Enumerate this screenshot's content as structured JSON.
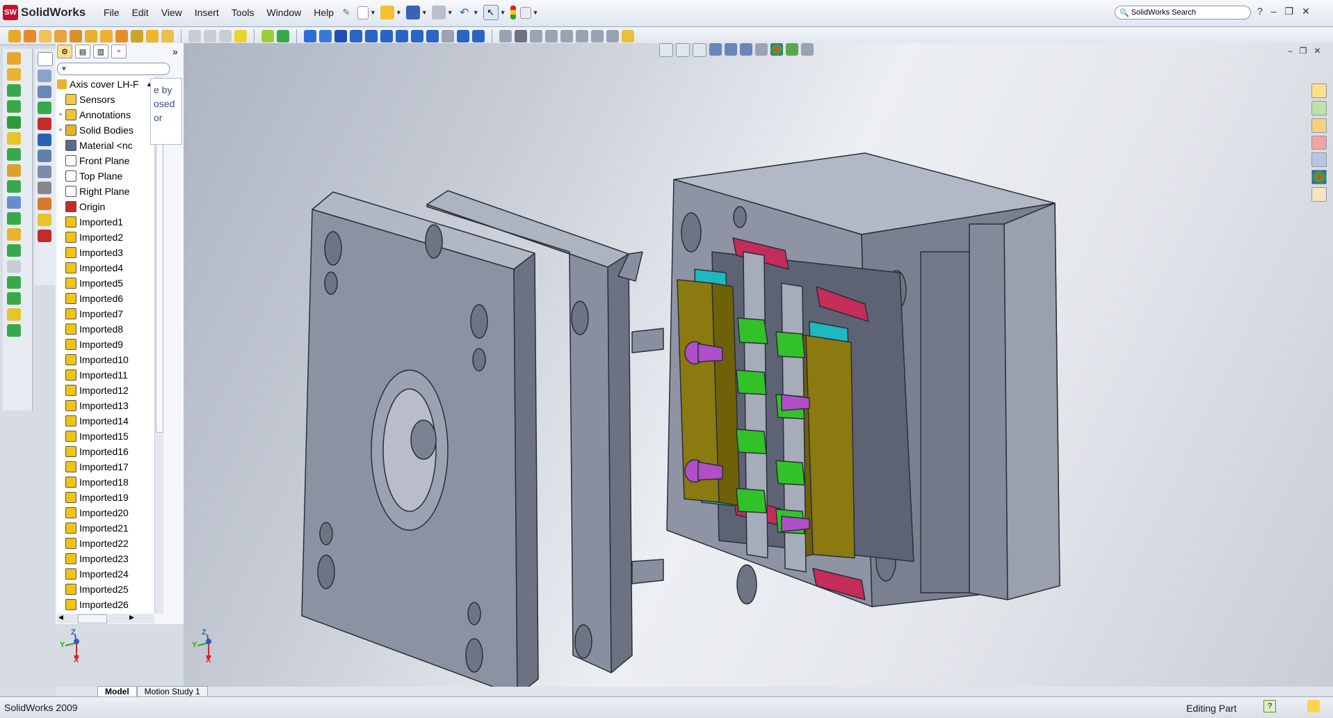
{
  "app": {
    "logo_text": "SolidWorks",
    "logo_badge": "SW",
    "menu": [
      "File",
      "Edit",
      "View",
      "Insert",
      "Tools",
      "Window",
      "Help"
    ],
    "search_placeholder": "SolidWorks Search"
  },
  "feature_manager": {
    "tabs": [
      "part-tab",
      "property-tab",
      "config-tab",
      "dimxpert-tab"
    ],
    "root": "Axis cover LH-F",
    "items": [
      {
        "label": "Sensors",
        "icon": "sensors-icon",
        "expandable": false
      },
      {
        "label": "Annotations",
        "icon": "annotations-icon",
        "expandable": true
      },
      {
        "label": "Solid Bodies",
        "icon": "solid-bodies-icon",
        "expandable": true
      },
      {
        "label": "Material <nc",
        "icon": "material-icon",
        "expandable": false
      },
      {
        "label": "Front Plane",
        "icon": "plane-icon",
        "expandable": false
      },
      {
        "label": "Top Plane",
        "icon": "plane-icon",
        "expandable": false
      },
      {
        "label": "Right Plane",
        "icon": "plane-icon",
        "expandable": false
      },
      {
        "label": "Origin",
        "icon": "origin-icon",
        "expandable": false
      },
      {
        "label": "Imported1",
        "icon": "imported-feature-icon",
        "expandable": false
      },
      {
        "label": "Imported2",
        "icon": "imported-feature-icon",
        "expandable": false
      },
      {
        "label": "Imported3",
        "icon": "imported-feature-icon",
        "expandable": false
      },
      {
        "label": "Imported4",
        "icon": "imported-feature-icon",
        "expandable": false
      },
      {
        "label": "Imported5",
        "icon": "imported-feature-icon",
        "expandable": false
      },
      {
        "label": "Imported6",
        "icon": "imported-feature-icon",
        "expandable": false
      },
      {
        "label": "Imported7",
        "icon": "imported-feature-icon",
        "expandable": false
      },
      {
        "label": "Imported8",
        "icon": "imported-feature-icon",
        "expandable": false
      },
      {
        "label": "Imported9",
        "icon": "imported-feature-icon",
        "expandable": false
      },
      {
        "label": "Imported10",
        "icon": "imported-feature-icon",
        "expandable": false
      },
      {
        "label": "Imported11",
        "icon": "imported-feature-icon",
        "expandable": false
      },
      {
        "label": "Imported12",
        "icon": "imported-feature-icon",
        "expandable": false
      },
      {
        "label": "Imported13",
        "icon": "imported-feature-icon",
        "expandable": false
      },
      {
        "label": "Imported14",
        "icon": "imported-feature-icon",
        "expandable": false
      },
      {
        "label": "Imported15",
        "icon": "imported-feature-icon",
        "expandable": false
      },
      {
        "label": "Imported16",
        "icon": "imported-feature-icon",
        "expandable": false
      },
      {
        "label": "Imported17",
        "icon": "imported-feature-icon",
        "expandable": false
      },
      {
        "label": "Imported18",
        "icon": "imported-feature-icon",
        "expandable": false
      },
      {
        "label": "Imported19",
        "icon": "imported-feature-icon",
        "expandable": false
      },
      {
        "label": "Imported20",
        "icon": "imported-feature-icon",
        "expandable": false
      },
      {
        "label": "Imported21",
        "icon": "imported-feature-icon",
        "expandable": false
      },
      {
        "label": "Imported22",
        "icon": "imported-feature-icon",
        "expandable": false
      },
      {
        "label": "Imported23",
        "icon": "imported-feature-icon",
        "expandable": false
      },
      {
        "label": "Imported24",
        "icon": "imported-feature-icon",
        "expandable": false
      },
      {
        "label": "Imported25",
        "icon": "imported-feature-icon",
        "expandable": false
      },
      {
        "label": "Imported26",
        "icon": "imported-feature-icon",
        "expandable": false
      }
    ],
    "tip_fragment": "e by\nosed\nor"
  },
  "triad": {
    "x": "X",
    "y": "Y",
    "z": "Z"
  },
  "bottom_tabs": [
    "Model",
    "Motion Study 1"
  ],
  "status": {
    "left": "SolidWorks 2009",
    "right": "Editing Part",
    "help_badge": "?"
  },
  "colors": {
    "mold_plate": "#8d92a3",
    "mold_edge": "#2b2e38",
    "insert_olive": "#8a7a10",
    "insert_cyan": "#1fb8c0",
    "slider_green": "#33c12a",
    "pin_purple": "#b04fc8",
    "lock_red": "#c42c5a"
  }
}
